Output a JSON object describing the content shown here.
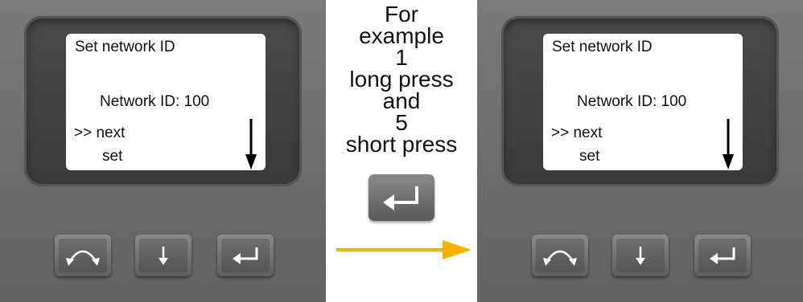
{
  "caption": {
    "line1": "For",
    "line2": "example",
    "line3": "1",
    "line4": "long press",
    "line5": "and",
    "line6": "5",
    "line7": "short press"
  },
  "left_screen": {
    "title": "Set network ID",
    "network_id": "Network ID: 100",
    "next": ">> next",
    "set": "set"
  },
  "right_screen": {
    "title": "Set network ID",
    "network_id": "Network ID: 100",
    "next": ">> next",
    "set": "set"
  },
  "icons": {
    "scroll": "scroll-cycle-icon",
    "down": "down-arrow-icon",
    "enter": "enter-return-icon",
    "flow": "right-arrow-icon"
  },
  "colors": {
    "flow_arrow": "#f5b200",
    "device_body": "#6e6e6e",
    "screen": "#ffffff"
  }
}
